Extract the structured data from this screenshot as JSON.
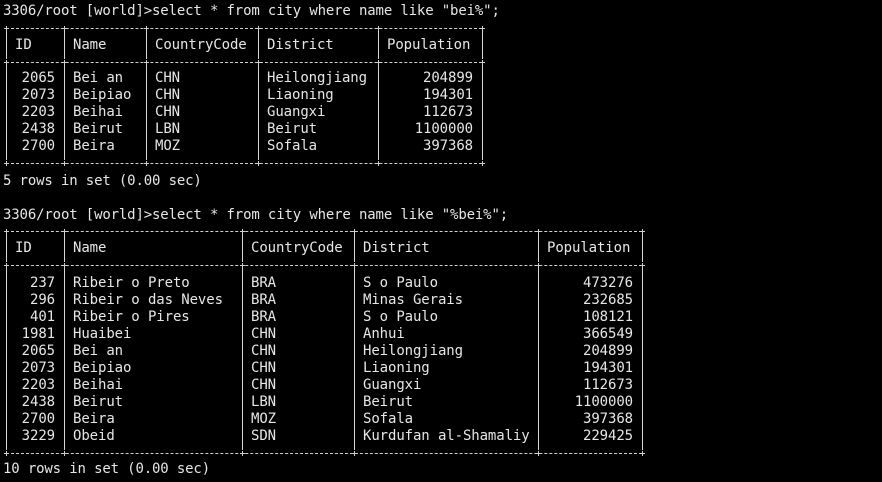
{
  "query1": {
    "prompt": "3306/root [world]>",
    "command": "select * from city where name like \"bei%\";",
    "columns": [
      "ID",
      "Name",
      "CountryCode",
      "District",
      "Population"
    ],
    "rows": [
      [
        "2065",
        "Bei an",
        "CHN",
        "Heilongjiang",
        "204899"
      ],
      [
        "2073",
        "Beipiao",
        "CHN",
        "Liaoning",
        "194301"
      ],
      [
        "2203",
        "Beihai",
        "CHN",
        "Guangxi",
        "112673"
      ],
      [
        "2438",
        "Beirut",
        "LBN",
        "Beirut",
        "1100000"
      ],
      [
        "2700",
        "Beira",
        "MOZ",
        "Sofala",
        "397368"
      ]
    ],
    "summary": "5 rows in set (0.00 sec)"
  },
  "query2": {
    "prompt": "3306/root [world]>",
    "command": "select * from city where name like \"%bei%\";",
    "columns": [
      "ID",
      "Name",
      "CountryCode",
      "District",
      "Population"
    ],
    "rows": [
      [
        "237",
        "Ribeir o Preto",
        "BRA",
        "S o Paulo",
        "473276"
      ],
      [
        "296",
        "Ribeir o das Neves",
        "BRA",
        "Minas Gerais",
        "232685"
      ],
      [
        "401",
        "Ribeir o Pires",
        "BRA",
        "S o Paulo",
        "108121"
      ],
      [
        "1981",
        "Huaibei",
        "CHN",
        "Anhui",
        "366549"
      ],
      [
        "2065",
        "Bei an",
        "CHN",
        "Heilongjiang",
        "204899"
      ],
      [
        "2073",
        "Beipiao",
        "CHN",
        "Liaoning",
        "194301"
      ],
      [
        "2203",
        "Beihai",
        "CHN",
        "Guangxi",
        "112673"
      ],
      [
        "2438",
        "Beirut",
        "LBN",
        "Beirut",
        "1100000"
      ],
      [
        "2700",
        "Beira",
        "MOZ",
        "Sofala",
        "397368"
      ],
      [
        "3229",
        "Obeid",
        "SDN",
        "Kurdufan al-Shamaliy",
        "229425"
      ]
    ],
    "summary": "10 rows in set (0.00 sec)"
  }
}
